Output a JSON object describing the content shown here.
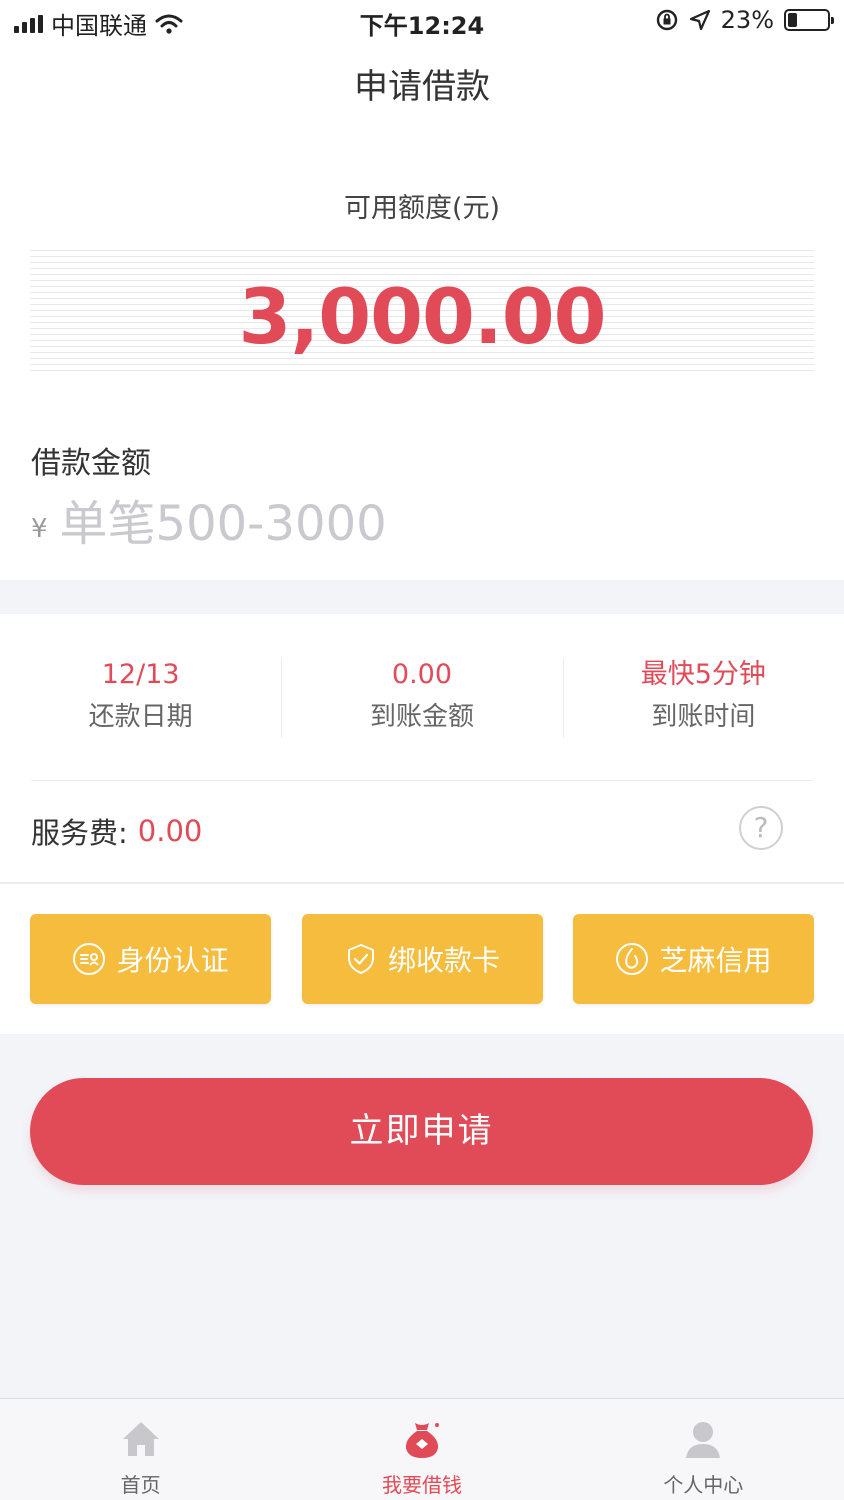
{
  "status_bar": {
    "carrier": "中国联通",
    "time": "下午12:24",
    "battery": "23%",
    "battery_level": 0.23
  },
  "nav": {
    "title": "申请借款"
  },
  "quota": {
    "label": "可用额度(元)",
    "amount": "3,000.00"
  },
  "loan_amount": {
    "title": "借款金额",
    "currency_symbol": "¥",
    "placeholder": "单笔500-3000"
  },
  "stats": [
    {
      "value": "12/13",
      "label": "还款日期"
    },
    {
      "value": "0.00",
      "label": "到账金额"
    },
    {
      "value": "最快5分钟",
      "label": "到账时间"
    }
  ],
  "fee": {
    "label": "服务费:",
    "value": "0.00",
    "help_icon": "?"
  },
  "certifications": [
    {
      "label": "身份认证",
      "icon": "id-card-icon"
    },
    {
      "label": "绑收款卡",
      "icon": "shield-icon"
    },
    {
      "label": "芝麻信用",
      "icon": "sesame-icon"
    }
  ],
  "apply_button": {
    "label": "立即申请"
  },
  "tabbar": {
    "tabs": [
      {
        "label": "首页",
        "icon": "home-icon",
        "active": false
      },
      {
        "label": "我要借钱",
        "icon": "money-bag-icon",
        "active": true
      },
      {
        "label": "个人中心",
        "icon": "user-icon",
        "active": false
      }
    ]
  },
  "colors": {
    "accent": "#e04b57",
    "gold": "#f5bc3d",
    "inactive_tab": "#c8c8cc"
  }
}
